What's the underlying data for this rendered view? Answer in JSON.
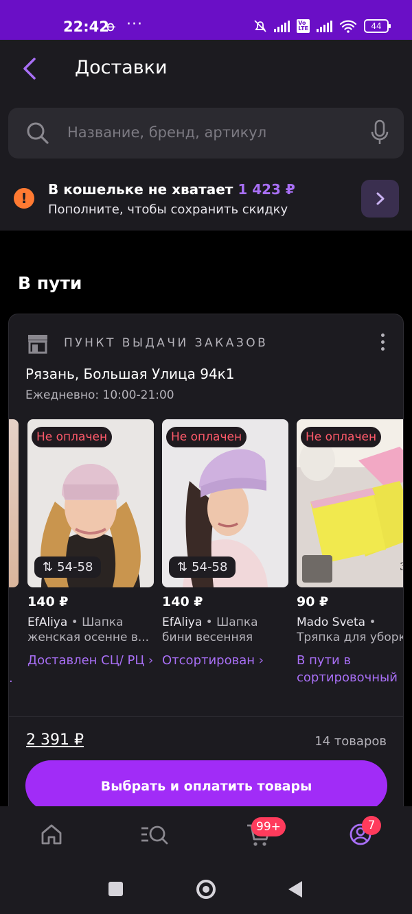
{
  "status_bar": {
    "time": "22:42",
    "battery": "44"
  },
  "header": {
    "title": "Доставки"
  },
  "search": {
    "placeholder": "Название, бренд, артикул"
  },
  "wallet": {
    "message": "В кошельке не хватает",
    "amount": "1 423 ₽",
    "hint": "Пополните, чтобы сохранить скидку"
  },
  "section": {
    "title": "В пути"
  },
  "pickup": {
    "type_label": "ПУНКТ ВЫДАЧИ ЗАКАЗОВ",
    "address": "Рязань, Большая Улица 94к1",
    "hours": "Ежедневно: 10:00-21:00"
  },
  "products": [
    {
      "badge": "Не оплачен",
      "size": "54-58",
      "price": "140 ₽",
      "brand": "EfAliya",
      "name": "Шапка женская осенне в...",
      "status": "Доставлен СЦ/ РЦ ›"
    },
    {
      "badge": "Не оплачен",
      "size": "54-58",
      "price": "140 ₽",
      "brand": "EfAliya",
      "name": "Шапка бини весенняя",
      "status": "Отсортирован ›"
    },
    {
      "badge": "Не оплачен",
      "price": "90 ₽",
      "brand": "Mado Sveta",
      "name": "Тряпка для уборки",
      "status": "В пути в сортировочный"
    }
  ],
  "order": {
    "total": "2 391 ₽",
    "count": "14 товаров",
    "pay_label": "Выбрать и оплатить товары"
  },
  "tabbar": {
    "cart_badge": "99+",
    "profile_badge": "7"
  },
  "colors": {
    "accent": "#a86ff5",
    "button": "#a12cf7",
    "warning": "#ff7a32",
    "statusbar": "#6a0fc6",
    "unpaid": "#ff5a6a"
  }
}
